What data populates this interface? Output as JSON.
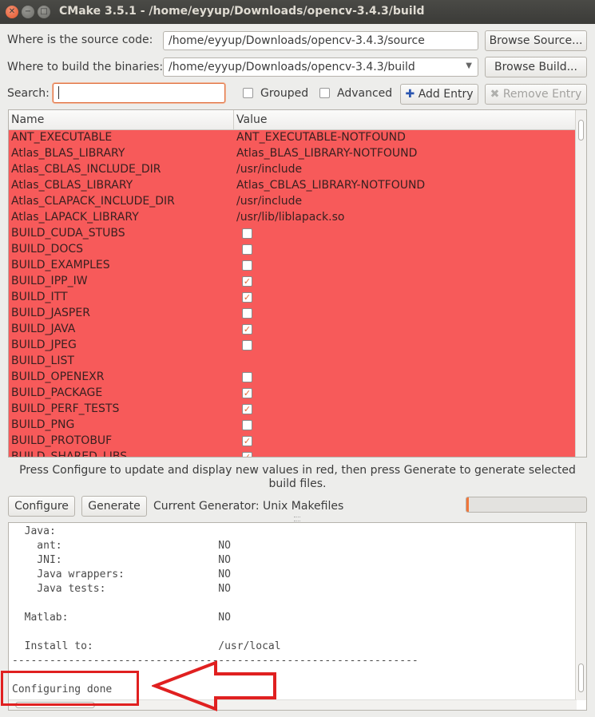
{
  "window": {
    "title": "CMake 3.5.1 - /home/eyyup/Downloads/opencv-3.4.3/build"
  },
  "source": {
    "label": "Where is the source code:",
    "value": "/home/eyyup/Downloads/opencv-3.4.3/source",
    "browse_label": "Browse Source..."
  },
  "build": {
    "label": "Where to build the binaries:",
    "value": "/home/eyyup/Downloads/opencv-3.4.3/build",
    "browse_label": "Browse Build..."
  },
  "search": {
    "label": "Search:",
    "value": ""
  },
  "options": {
    "grouped_label": "Grouped",
    "grouped_checked": false,
    "advanced_label": "Advanced",
    "advanced_checked": false,
    "add_entry_label": "Add Entry",
    "remove_entry_label": "Remove Entry"
  },
  "table": {
    "headers": {
      "name": "Name",
      "value": "Value"
    },
    "row_color": "#f75a5a",
    "rows": [
      {
        "name": "ANT_EXECUTABLE",
        "value": "ANT_EXECUTABLE-NOTFOUND"
      },
      {
        "name": "Atlas_BLAS_LIBRARY",
        "value": "Atlas_BLAS_LIBRARY-NOTFOUND"
      },
      {
        "name": "Atlas_CBLAS_INCLUDE_DIR",
        "value": "/usr/include"
      },
      {
        "name": "Atlas_CBLAS_LIBRARY",
        "value": "Atlas_CBLAS_LIBRARY-NOTFOUND"
      },
      {
        "name": "Atlas_CLAPACK_INCLUDE_DIR",
        "value": "/usr/include"
      },
      {
        "name": "Atlas_LAPACK_LIBRARY",
        "value": "/usr/lib/liblapack.so"
      },
      {
        "name": "BUILD_CUDA_STUBS",
        "checked": false
      },
      {
        "name": "BUILD_DOCS",
        "checked": false
      },
      {
        "name": "BUILD_EXAMPLES",
        "checked": false
      },
      {
        "name": "BUILD_IPP_IW",
        "checked": true
      },
      {
        "name": "BUILD_ITT",
        "checked": true
      },
      {
        "name": "BUILD_JASPER",
        "checked": false
      },
      {
        "name": "BUILD_JAVA",
        "checked": true
      },
      {
        "name": "BUILD_JPEG",
        "checked": false
      },
      {
        "name": "BUILD_LIST",
        "value": ""
      },
      {
        "name": "BUILD_OPENEXR",
        "checked": false
      },
      {
        "name": "BUILD_PACKAGE",
        "checked": true
      },
      {
        "name": "BUILD_PERF_TESTS",
        "checked": true
      },
      {
        "name": "BUILD_PNG",
        "checked": false
      },
      {
        "name": "BUILD_PROTOBUF",
        "checked": true
      },
      {
        "name": "BUILD_SHARED_LIBS",
        "checked": true
      }
    ]
  },
  "info_text": "Press Configure to update and display new values in red, then press Generate to generate selected build files.",
  "actions": {
    "configure_label": "Configure",
    "generate_label": "Generate",
    "generator_text": "Current Generator: Unix Makefiles"
  },
  "progress": {
    "fraction": 0.02,
    "color": "#f0763a"
  },
  "log": {
    "lines": [
      "  Java:",
      "    ant:                         NO",
      "    JNI:                         NO",
      "    Java wrappers:               NO",
      "    Java tests:                  NO",
      "",
      "  Matlab:                        NO",
      "",
      "  Install to:                    /usr/local",
      "-----------------------------------------------------------------",
      "",
      "Configuring done"
    ]
  }
}
